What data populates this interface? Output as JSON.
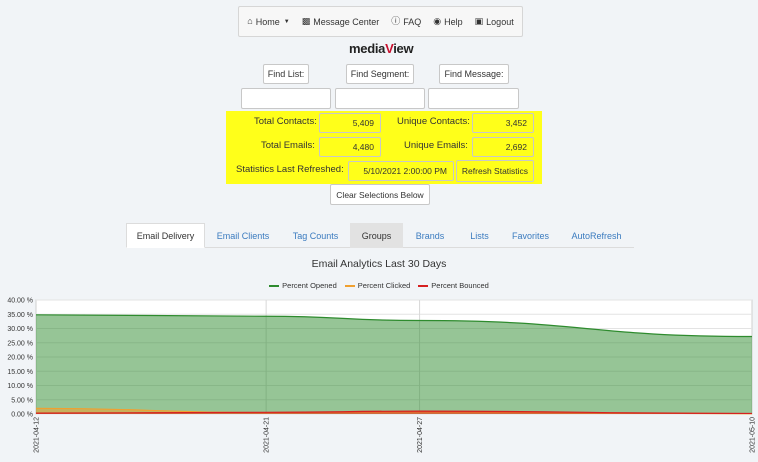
{
  "nav": {
    "home": "Home",
    "message_center": "Message Center",
    "faq": "FAQ",
    "help": "Help",
    "logout": "Logout"
  },
  "logo": {
    "pre": "media",
    "post": "iew"
  },
  "find": {
    "list_label": "Find List:",
    "segment_label": "Find Segment:",
    "message_label": "Find Message:"
  },
  "stats": {
    "total_contacts_label": "Total Contacts:",
    "total_contacts": "5,409",
    "unique_contacts_label": "Unique Contacts:",
    "unique_contacts": "3,452",
    "total_emails_label": "Total Emails:",
    "total_emails": "4,480",
    "unique_emails_label": "Unique Emails:",
    "unique_emails": "2,692",
    "refreshed_label": "Statistics Last Refreshed:",
    "refreshed_value": "5/10/2021 2:00:00 PM",
    "refresh_button": "Refresh Statistics"
  },
  "clear_button": "Clear Selections Below",
  "tabs": [
    {
      "label": "Email Delivery"
    },
    {
      "label": "Email Clients"
    },
    {
      "label": "Tag Counts"
    },
    {
      "label": "Groups"
    },
    {
      "label": "Brands"
    },
    {
      "label": "Lists"
    },
    {
      "label": "Favorites"
    },
    {
      "label": "AutoRefresh"
    }
  ],
  "colors": {
    "highlight": "#ffff1a",
    "link": "#3b7bbf",
    "opened": "#2e8b2e",
    "clicked": "#f0a030",
    "bounced": "#d62020"
  },
  "chart_data": {
    "type": "area",
    "title": "Email Analytics Last 30 Days",
    "x": [
      "2021-04-12",
      "2021-04-21",
      "2021-04-27",
      "2021-05-10"
    ],
    "ylim": [
      0,
      40
    ],
    "yticks": [
      "0.00 %",
      "5.00 %",
      "10.00 %",
      "15.00 %",
      "20.00 %",
      "25.00 %",
      "30.00 %",
      "35.00 %",
      "40.00 %"
    ],
    "grid": true,
    "legend_position": "top",
    "series": [
      {
        "name": "Percent Opened",
        "color": "#2e8b2e",
        "values": [
          34.8,
          34.3,
          32.8,
          27.2
        ]
      },
      {
        "name": "Percent Clicked",
        "color": "#f0a030",
        "values": [
          2.0,
          0.5,
          0.7,
          0.1
        ]
      },
      {
        "name": "Percent Bounced",
        "color": "#d62020",
        "values": [
          0.3,
          0.6,
          1.0,
          0.2
        ]
      }
    ]
  }
}
